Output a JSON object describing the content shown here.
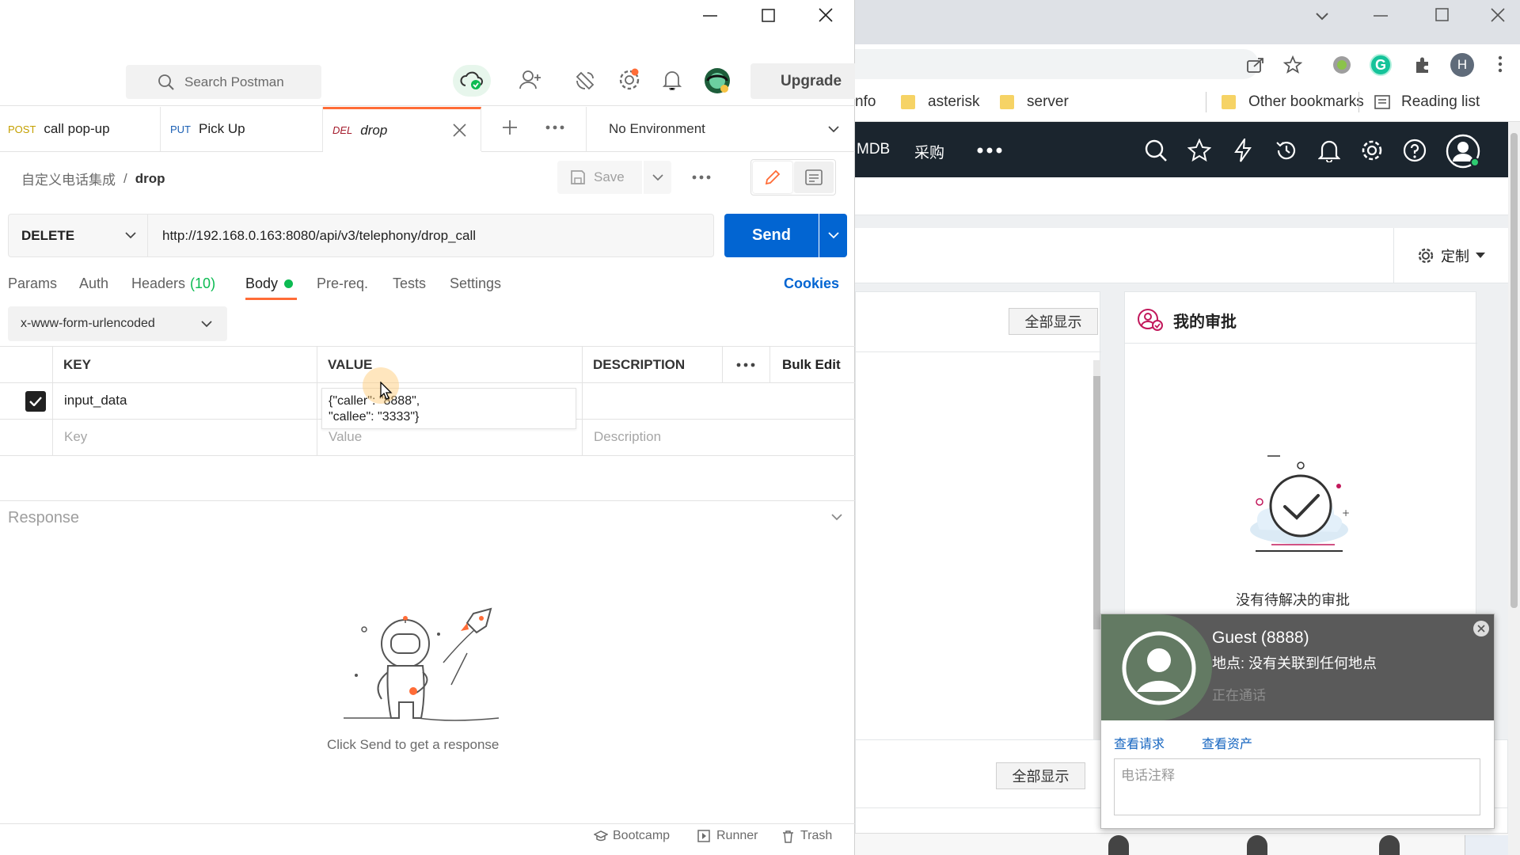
{
  "postman": {
    "search_placeholder": "Search Postman",
    "upgrade_label": "Upgrade",
    "tabs": [
      {
        "method": "POST",
        "name": "call pop-up",
        "method_color": "#c4a000"
      },
      {
        "method": "PUT",
        "name": "Pick Up",
        "method_color": "#1a5fb4"
      },
      {
        "method": "DEL",
        "name": "drop",
        "method_color": "#a51d2d"
      }
    ],
    "environment": "No Environment",
    "breadcrumb": {
      "collection": "自定义电话集成",
      "separator": "/",
      "request": "drop"
    },
    "save_label": "Save",
    "method": "DELETE",
    "url": "http://192.168.0.163:8080/api/v3/telephony/drop_call",
    "send_label": "Send",
    "request_tabs": {
      "params": "Params",
      "auth": "Auth",
      "headers": "Headers",
      "headers_count": "(10)",
      "body": "Body",
      "prereq": "Pre-req.",
      "tests": "Tests",
      "settings": "Settings"
    },
    "cookies_label": "Cookies",
    "body_type": "x-www-form-urlencoded",
    "table": {
      "col_key": "KEY",
      "col_value": "VALUE",
      "col_desc": "DESCRIPTION",
      "bulk_edit": "Bulk Edit",
      "rows": [
        {
          "key": "input_data",
          "value_line1": "{\"caller\": \"8888\",",
          "value_line2": "\"callee\": \"3333\"}",
          "checked": true
        }
      ],
      "placeholder_key": "Key",
      "placeholder_value": "Value",
      "placeholder_desc": "Description"
    },
    "response_label": "Response",
    "response_hint": "Click Send to get a response",
    "footer": {
      "bootcamp": "Bootcamp",
      "runner": "Runner",
      "trash": "Trash"
    },
    "accent": "#ff6c37",
    "send_color": "#0265d2"
  },
  "browser": {
    "bookmarks": [
      "nfo",
      "asterisk",
      "server"
    ],
    "other_bookmarks": "Other bookmarks",
    "reading_list": "Reading list",
    "profile_initial": "H",
    "nav_items": [
      "MDB",
      "采购"
    ],
    "customize_label": "定制",
    "show_all_1": "全部显示",
    "show_all_2": "全部显示",
    "approval_title": "我的审批",
    "approval_empty": "没有待解决的审批",
    "call": {
      "caller": "Guest (8888)",
      "location": "地点: 没有关联到任何地点",
      "status": "正在通话",
      "view_request": "查看请求",
      "view_asset": "查看资产",
      "note_placeholder": "电话注释"
    }
  }
}
